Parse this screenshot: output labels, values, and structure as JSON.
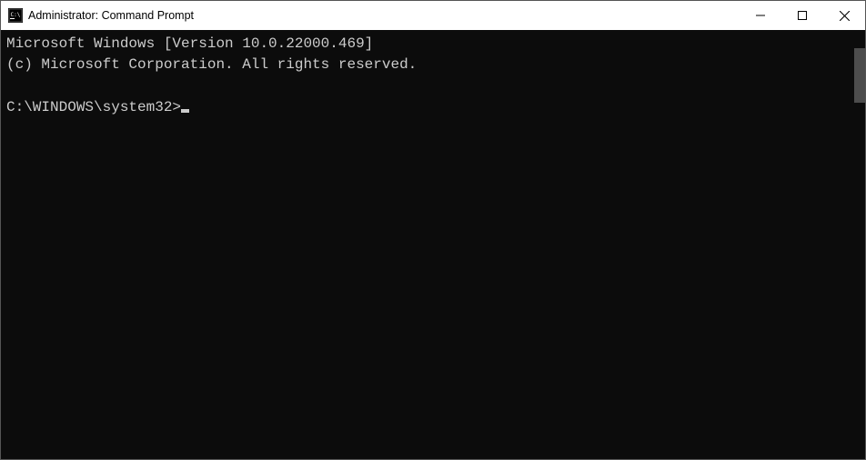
{
  "window": {
    "title": "Administrator: Command Prompt"
  },
  "terminal": {
    "version_line": "Microsoft Windows [Version 10.0.22000.469]",
    "copyright_line": "(c) Microsoft Corporation. All rights reserved.",
    "prompt": "C:\\WINDOWS\\system32>"
  }
}
